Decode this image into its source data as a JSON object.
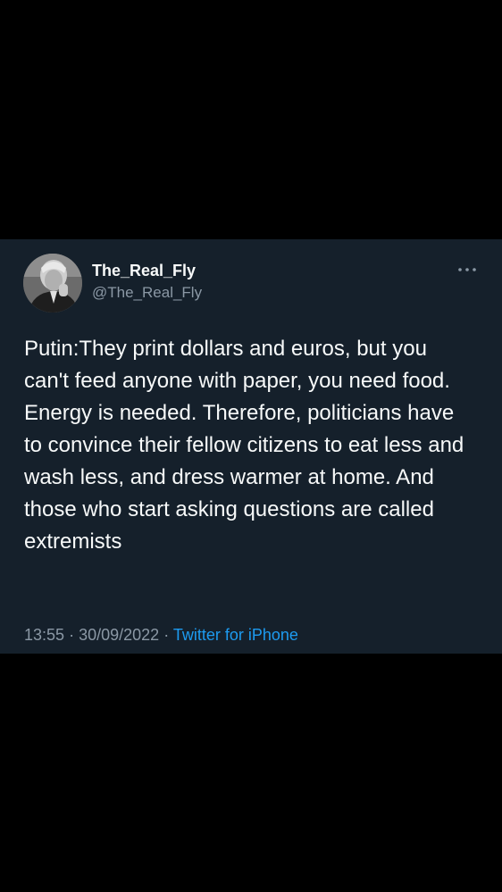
{
  "tweet": {
    "display_name": "The_Real_Fly",
    "handle": "@The_Real_Fly",
    "text": "Putin:They print dollars and euros, but you can't feed anyone with paper, you need food. Energy is needed. Therefore, politicians have to convince their fellow citizens to eat less and wash less, and dress warmer at home. And those who start asking questions are called extremists",
    "time": "13:55",
    "separator": "·",
    "date": "30/09/2022",
    "source": "Twitter for iPhone"
  },
  "icons": {
    "more": "more-horizontal-icon",
    "avatar": "profile-photo"
  },
  "colors": {
    "background": "#000000",
    "card": "#15202b",
    "text_primary": "#f7f9f9",
    "text_secondary": "#8b98a5",
    "link": "#1d9bf0"
  }
}
